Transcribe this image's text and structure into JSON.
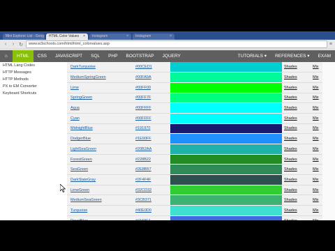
{
  "browser": {
    "tabs": [
      {
        "label": "Mini Explorer List - Goog",
        "active": false
      },
      {
        "label": "HTML Color Values",
        "active": true
      },
      {
        "label": "Instagram",
        "active": false
      },
      {
        "label": "Instagram",
        "active": false
      }
    ],
    "url": "www.w3schools.com/html/html_colorvalues.asp"
  },
  "navbar": {
    "items": [
      "HTML",
      "CSS",
      "JAVASCRIPT",
      "SQL",
      "PHP",
      "BOOTSTRAP",
      "JQUERY"
    ],
    "right_items": [
      "TUTORIALS ▾",
      "REFERENCES ▾",
      "EXAM"
    ]
  },
  "sidebar": {
    "links": [
      "HTML Lang Codes",
      "HTTP Messages",
      "HTTP Methods",
      "PX to EM Converter",
      "Keyboard Shortcuts"
    ]
  },
  "colors": [
    {
      "name": "DarkTurquoise",
      "hex": "#00CED1",
      "shades": "Shades",
      "mix": "Mix"
    },
    {
      "name": "MediumSpringGreen",
      "hex": "#00FA9A",
      "shades": "Shades",
      "mix": "Mix"
    },
    {
      "name": "Lime",
      "hex": "#00FF00",
      "shades": "Shades",
      "mix": "Mix"
    },
    {
      "name": "SpringGreen",
      "hex": "#00FF7F",
      "shades": "Shades",
      "mix": "Mix"
    },
    {
      "name": "Aqua",
      "hex": "#00FFFF",
      "shades": "Shades",
      "mix": "Mix"
    },
    {
      "name": "Cyan",
      "hex": "#00FFFF",
      "shades": "Shades",
      "mix": "Mix"
    },
    {
      "name": "MidnightBlue",
      "hex": "#191970",
      "shades": "Shades",
      "mix": "Mix"
    },
    {
      "name": "DodgerBlue",
      "hex": "#1E90FF",
      "shades": "Shades",
      "mix": "Mix"
    },
    {
      "name": "LightSeaGreen",
      "hex": "#20B2AA",
      "shades": "Shades",
      "mix": "Mix"
    },
    {
      "name": "ForestGreen",
      "hex": "#228B22",
      "shades": "Shades",
      "mix": "Mix"
    },
    {
      "name": "SeaGreen",
      "hex": "#2E8B57",
      "shades": "Shades",
      "mix": "Mix"
    },
    {
      "name": "DarkSlateGray",
      "hex": "#2F4F4F",
      "shades": "Shades",
      "mix": "Mix"
    },
    {
      "name": "LimeGreen",
      "hex": "#32CD32",
      "shades": "Shades",
      "mix": "Mix"
    },
    {
      "name": "MediumSeaGreen",
      "hex": "#3CB371",
      "shades": "Shades",
      "mix": "Mix"
    },
    {
      "name": "Turquoise",
      "hex": "#40E0D0",
      "shades": "Shades",
      "mix": "Mix"
    },
    {
      "name": "RoyalBlue",
      "hex": "#4169E1",
      "shades": "Shades",
      "mix": "Mix"
    }
  ],
  "theme": {
    "nav_active": "#8ac007",
    "nav_bg": "#5f5f5f",
    "link": "#1a5aa0"
  }
}
